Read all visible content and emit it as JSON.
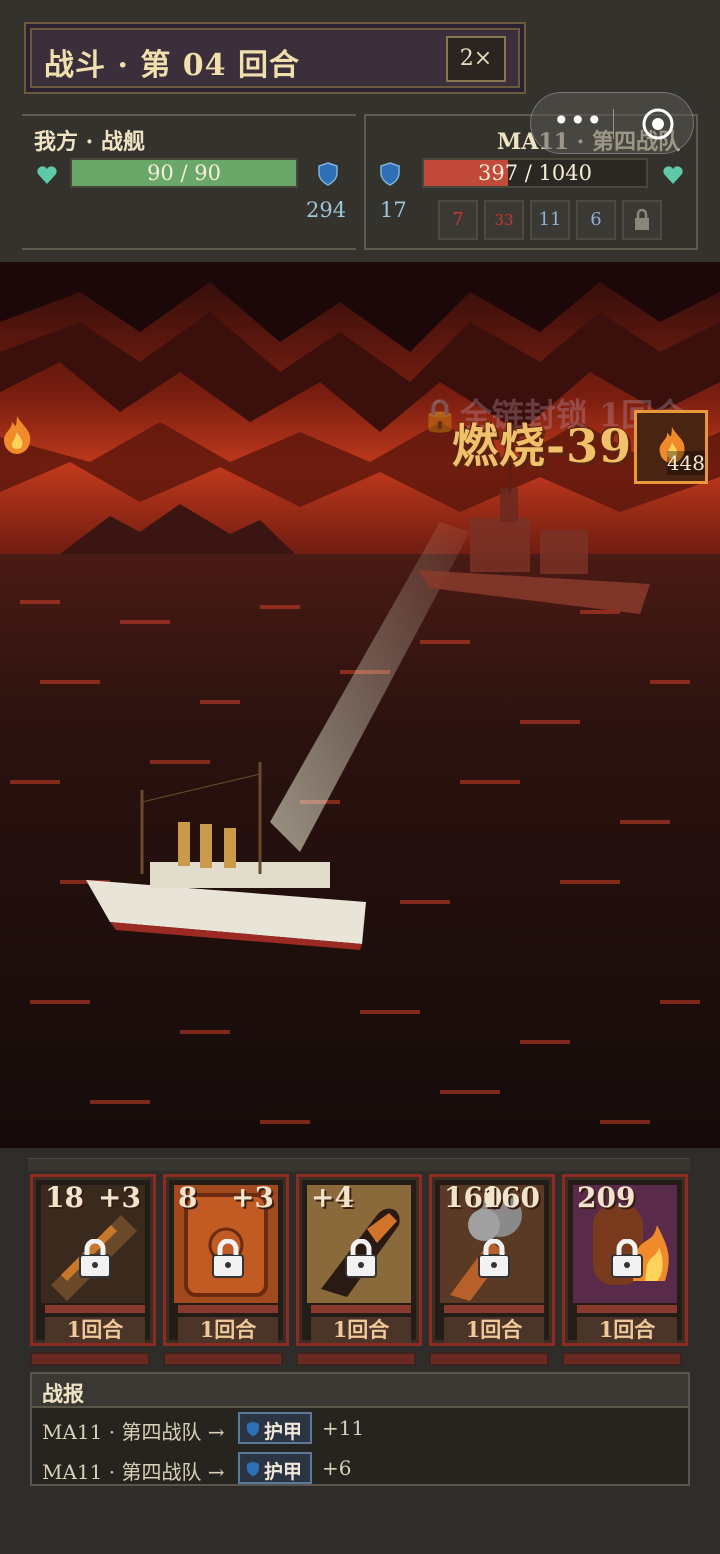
{
  "header": {
    "round_title": "战斗 · 第 04 回合",
    "speed": "2×"
  },
  "player": {
    "name": "我方 · 战舰",
    "hp": "90 / 90",
    "hp_ratio": 1.0,
    "armor": "294"
  },
  "enemy": {
    "name": "MA11 · 第四战队",
    "hp": "397 / 1040",
    "hp_ratio": 0.38,
    "armor": "17",
    "statuses": [
      {
        "icon": "burst-icon",
        "value": "7"
      },
      {
        "icon": "burst-icon",
        "value": "33"
      },
      {
        "icon": "pillar-icon",
        "value": "11"
      },
      {
        "icon": "shield-status-icon",
        "value": "6"
      },
      {
        "icon": "lock-icon",
        "value": ""
      }
    ]
  },
  "battle": {
    "float_text": "燃烧-397",
    "faded_text": "🔒全链封锁 1回合",
    "burn_badge_value": "448"
  },
  "cards": [
    {
      "cost": "18",
      "bonus": "+3",
      "turns": "1回合",
      "art": "bomb"
    },
    {
      "cost": "8",
      "bonus": "+3",
      "turns": "1回合",
      "art": "plate"
    },
    {
      "cost": "",
      "bonus": "+4",
      "turns": "1回合",
      "art": "shell"
    },
    {
      "cost": "160",
      "bonus": "160",
      "turns": "1回合",
      "art": "cannon"
    },
    {
      "cost": "209",
      "bonus": "",
      "turns": "1回合",
      "art": "furnace"
    }
  ],
  "log": {
    "title": "战报",
    "rows": [
      {
        "actor": "MA11 · 第四战队 →",
        "badge": "护甲",
        "value": "+11"
      },
      {
        "actor": "MA11 · 第四战队 →",
        "badge": "护甲",
        "value": "+6"
      }
    ]
  },
  "colors": {
    "hp_player": "#6aa86a",
    "hp_enemy": "#c24a3a",
    "accent": "#e89a3a"
  }
}
